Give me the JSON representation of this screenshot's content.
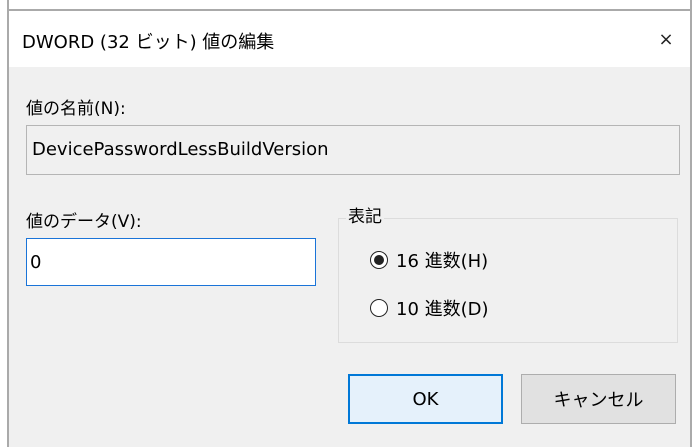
{
  "dialog": {
    "title": "DWORD (32 ビット) 値の編集",
    "close_glyph": "×"
  },
  "value_name": {
    "label": "値の名前(N):",
    "value": "DevicePasswordLessBuildVersion"
  },
  "value_data": {
    "label": "値のデータ(V):",
    "value": "0"
  },
  "base": {
    "title": "表記",
    "options": [
      {
        "label": "16 進数(H)",
        "selected": true
      },
      {
        "label": "10 進数(D)",
        "selected": false
      }
    ]
  },
  "buttons": {
    "ok": "OK",
    "cancel": "キャンセル"
  },
  "colors": {
    "accent": "#0078d7",
    "dialog_bg": "#f0f0f0"
  },
  "icons": {
    "close": "close-icon"
  }
}
